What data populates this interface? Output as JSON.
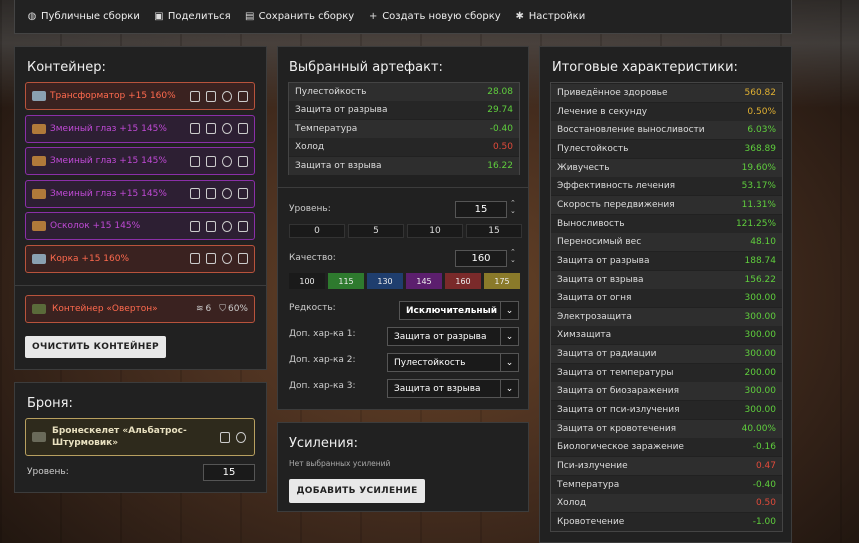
{
  "topbar": {
    "items": [
      {
        "icon": "globe-icon",
        "label": "Публичные сборки"
      },
      {
        "icon": "image-icon",
        "label": "Поделиться"
      },
      {
        "icon": "save-icon",
        "label": "Сохранить сборку"
      },
      {
        "icon": "plus-icon",
        "label": "Создать новую сборку"
      },
      {
        "icon": "gear-icon",
        "label": "Настройки"
      }
    ]
  },
  "container": {
    "title": "Контейнер:",
    "slots": [
      {
        "name": "Трансформатор +15 160%",
        "color": "red"
      },
      {
        "name": "Змеиный глаз +15 145%",
        "color": "purple"
      },
      {
        "name": "Змеиный глаз +15 145%",
        "color": "purple"
      },
      {
        "name": "Змеиный глаз +15 145%",
        "color": "purple"
      },
      {
        "name": "Осколок +15 145%",
        "color": "purple"
      },
      {
        "name": "Корка +15 160%",
        "color": "red"
      }
    ],
    "container_item": {
      "name": "Контейнер «Овертон»",
      "slots": "6",
      "protection": "60%"
    },
    "clear_label": "ОЧИСТИТЬ КОНТЕЙНЕР"
  },
  "armor": {
    "title": "Броня:",
    "name": "Бронескелет «Альбатрос-Штурмовик»",
    "level_label": "Уровень:",
    "level": "15"
  },
  "artifact": {
    "title": "Выбранный артефакт:",
    "stats": [
      {
        "name": "Пулестойкость",
        "value": "28.08",
        "tone": "pos"
      },
      {
        "name": "Защита от разрыва",
        "value": "29.74",
        "tone": "pos"
      },
      {
        "name": "Температура",
        "value": "-0.40",
        "tone": "pos"
      },
      {
        "name": "Холод",
        "value": "0.50",
        "tone": "neg"
      },
      {
        "name": "Защита от взрыва",
        "value": "16.22",
        "tone": "pos"
      }
    ],
    "level_label": "Уровень:",
    "level": "15",
    "level_buttons": [
      "0",
      "5",
      "10",
      "15"
    ],
    "quality_label": "Качество:",
    "quality": "160",
    "quality_buttons": [
      {
        "label": "100",
        "color": "#1a1a1a"
      },
      {
        "label": "115",
        "color": "#2e7a2e"
      },
      {
        "label": "130",
        "color": "#1f3e6e"
      },
      {
        "label": "145",
        "color": "#5c1f6e"
      },
      {
        "label": "160",
        "color": "#7a2a2a"
      },
      {
        "label": "175",
        "color": "#8a7a2a"
      }
    ],
    "rarity_label": "Редкость:",
    "rarity": "Исключительный",
    "extra1_label": "Доп. хар-ка 1:",
    "extra1": "Защита от разрыва",
    "extra2_label": "Доп. хар-ка 2:",
    "extra2": "Пулестойкость",
    "extra3_label": "Доп. хар-ка 3:",
    "extra3": "Защита от взрыва"
  },
  "boosts": {
    "title": "Усиления:",
    "empty": "Нет выбранных усилений",
    "add_label": "ДОБАВИТЬ УСИЛЕНИЕ"
  },
  "totals": {
    "title": "Итоговые характеристики:",
    "stats": [
      {
        "name": "Приведённое здоровье",
        "value": "560.82",
        "tone": "gold"
      },
      {
        "name": "Лечение в секунду",
        "value": "0.50%",
        "tone": "gold"
      },
      {
        "name": "Восстановление выносливости",
        "value": "6.03%",
        "tone": "pos"
      },
      {
        "name": "Пулестойкость",
        "value": "368.89",
        "tone": "pos"
      },
      {
        "name": "Живучесть",
        "value": "19.60%",
        "tone": "pos"
      },
      {
        "name": "Эффективность лечения",
        "value": "53.17%",
        "tone": "pos"
      },
      {
        "name": "Скорость передвижения",
        "value": "11.31%",
        "tone": "pos"
      },
      {
        "name": "Выносливость",
        "value": "121.25%",
        "tone": "pos"
      },
      {
        "name": "Переносимый вес",
        "value": "48.10",
        "tone": "pos"
      },
      {
        "name": "Защита от разрыва",
        "value": "188.74",
        "tone": "pos"
      },
      {
        "name": "Защита от взрыва",
        "value": "156.22",
        "tone": "pos"
      },
      {
        "name": "Защита от огня",
        "value": "300.00",
        "tone": "pos"
      },
      {
        "name": "Электрозащита",
        "value": "300.00",
        "tone": "pos"
      },
      {
        "name": "Химзащита",
        "value": "300.00",
        "tone": "pos"
      },
      {
        "name": "Защита от радиации",
        "value": "300.00",
        "tone": "pos"
      },
      {
        "name": "Защита от температуры",
        "value": "200.00",
        "tone": "pos"
      },
      {
        "name": "Защита от биозаражения",
        "value": "300.00",
        "tone": "pos"
      },
      {
        "name": "Защита от пси-излучения",
        "value": "300.00",
        "tone": "pos"
      },
      {
        "name": "Защита от кровотечения",
        "value": "40.00%",
        "tone": "pos"
      },
      {
        "name": "Биологическое заражение",
        "value": "-0.16",
        "tone": "pos"
      },
      {
        "name": "Пси-излучение",
        "value": "0.47",
        "tone": "neg"
      },
      {
        "name": "Температура",
        "value": "-0.40",
        "tone": "pos"
      },
      {
        "name": "Холод",
        "value": "0.50",
        "tone": "neg"
      },
      {
        "name": "Кровотечение",
        "value": "-1.00",
        "tone": "pos"
      }
    ]
  }
}
